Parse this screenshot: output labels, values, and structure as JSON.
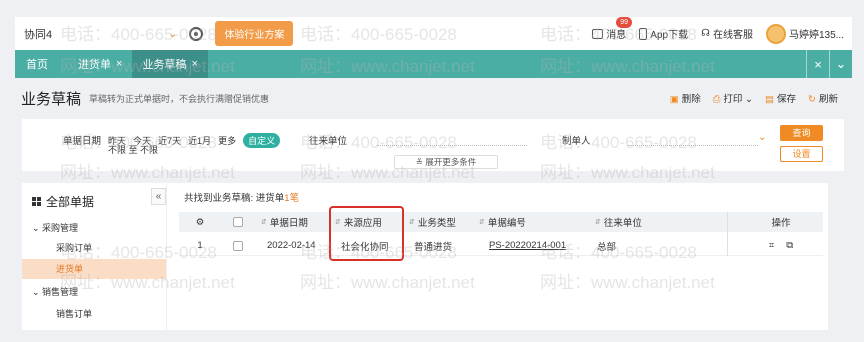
{
  "topbar": {
    "company": "协同4",
    "cta": "体验行业方案",
    "message_label": "消息",
    "message_badge": "99",
    "app_label": "App下载",
    "service_label": "在线客服",
    "user_name": "马婷婷135..."
  },
  "tabs": {
    "home": "首页",
    "items": [
      {
        "label": "进货单",
        "close": "×"
      },
      {
        "label": "业务草稿",
        "close": "×"
      }
    ]
  },
  "page": {
    "title": "业务草稿",
    "subtitle": "草稿转为正式单据时，不会执行满赠促销优惠",
    "actions": {
      "delete": "删除",
      "print": "打印",
      "save": "保存",
      "refresh": "刷新"
    }
  },
  "filter": {
    "date_label": "单据日期",
    "date_options": [
      "昨天",
      "今天",
      "近7天",
      "近1月",
      "更多"
    ],
    "date_selected": "自定义",
    "date_range": "不限 至 不限",
    "partner_label": "往来单位",
    "maker_label": "制单人",
    "query": "查询",
    "settings": "设置",
    "expand": "展开更多条件"
  },
  "tree": {
    "head": "全部单据",
    "groups": [
      {
        "label": "采购管理",
        "items": [
          "采购订单",
          "进货单"
        ]
      },
      {
        "label": "销售管理",
        "items": [
          "销售订单"
        ]
      }
    ]
  },
  "table": {
    "found_prefix": "共找到业务草稿: 进货单",
    "found_count": "1笔",
    "headers": [
      "单据日期",
      "来源应用",
      "业务类型",
      "单据编号",
      "往来单位",
      "操作"
    ],
    "rows": [
      {
        "index": "1",
        "date": "2022-02-14",
        "source": "社会化协同",
        "type": "普通进货",
        "number": "PS-20220214-001",
        "partner": "总部"
      }
    ]
  },
  "watermark": {
    "phone": "电话：400-665-0028",
    "site": "网址：www.chanjet.net"
  },
  "colors": {
    "accent": "#f08a24",
    "teal": "#4aaea5",
    "highlight": "#d8312a"
  }
}
